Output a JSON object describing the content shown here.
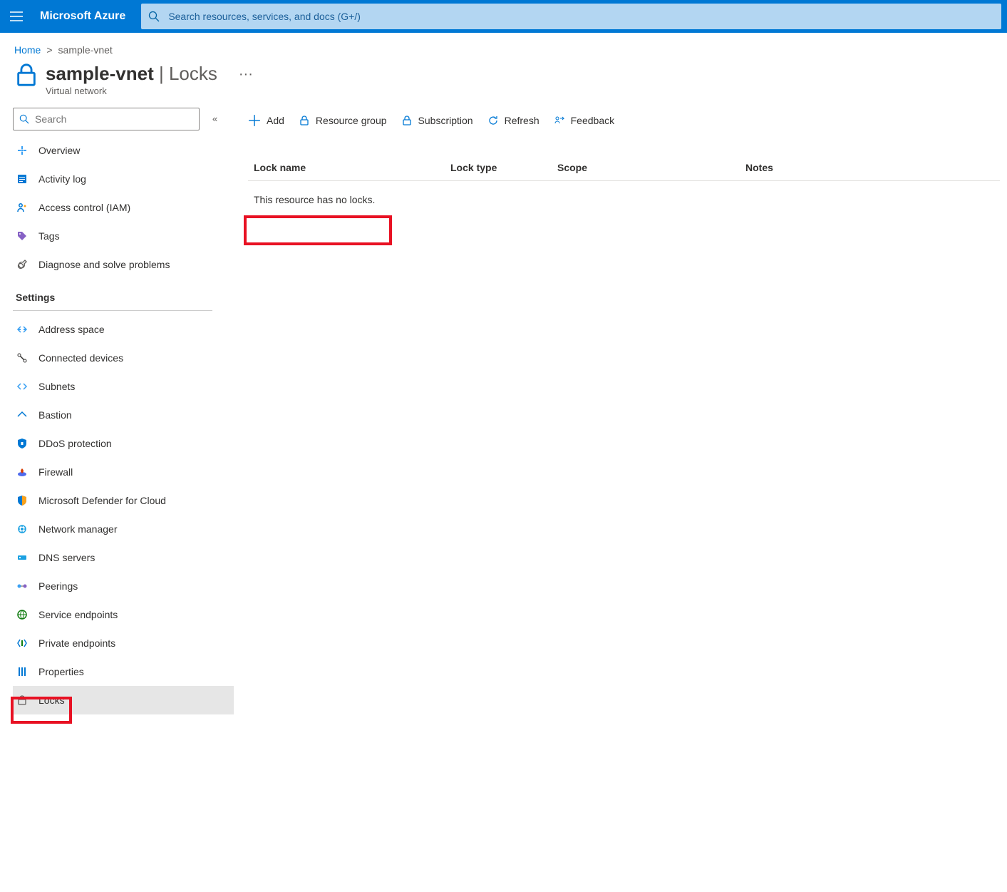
{
  "brand": "Microsoft Azure",
  "search_placeholder": "Search resources, services, and docs (G+/)",
  "breadcrumb": {
    "home": "Home",
    "current": "sample-vnet"
  },
  "title": {
    "name": "sample-vnet",
    "section": "Locks",
    "subtitle": "Virtual network"
  },
  "sidebar_search_placeholder": "Search",
  "sidebar": {
    "top_items": [
      {
        "label": "Overview",
        "key": "overview"
      },
      {
        "label": "Activity log",
        "key": "activity-log"
      },
      {
        "label": "Access control (IAM)",
        "key": "access-control"
      },
      {
        "label": "Tags",
        "key": "tags"
      },
      {
        "label": "Diagnose and solve problems",
        "key": "diagnose"
      }
    ],
    "settings_label": "Settings",
    "settings_items": [
      {
        "label": "Address space",
        "key": "address-space"
      },
      {
        "label": "Connected devices",
        "key": "connected-devices"
      },
      {
        "label": "Subnets",
        "key": "subnets"
      },
      {
        "label": "Bastion",
        "key": "bastion"
      },
      {
        "label": "DDoS protection",
        "key": "ddos"
      },
      {
        "label": "Firewall",
        "key": "firewall"
      },
      {
        "label": "Microsoft Defender for Cloud",
        "key": "defender"
      },
      {
        "label": "Network manager",
        "key": "network-manager"
      },
      {
        "label": "DNS servers",
        "key": "dns-servers"
      },
      {
        "label": "Peerings",
        "key": "peerings"
      },
      {
        "label": "Service endpoints",
        "key": "service-endpoints"
      },
      {
        "label": "Private endpoints",
        "key": "private-endpoints"
      },
      {
        "label": "Properties",
        "key": "properties"
      },
      {
        "label": "Locks",
        "key": "locks"
      }
    ]
  },
  "toolbar": {
    "add": "Add",
    "resource_group": "Resource group",
    "subscription": "Subscription",
    "refresh": "Refresh",
    "feedback": "Feedback"
  },
  "table": {
    "columns": {
      "name": "Lock name",
      "type": "Lock type",
      "scope": "Scope",
      "notes": "Notes"
    },
    "empty_message": "This resource has no locks."
  }
}
